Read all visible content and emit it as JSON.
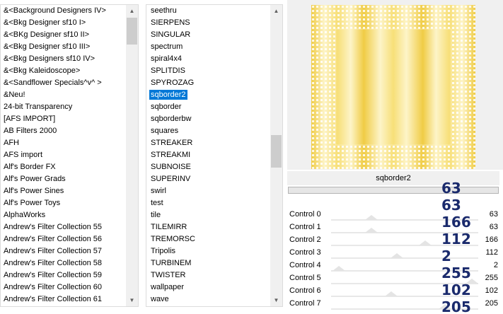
{
  "categories": {
    "items": [
      "&<Background Designers IV>",
      "&<Bkg Designer sf10 I>",
      "&<BKg Designer sf10 II>",
      "&<Bkg Designer sf10 III>",
      "&<Bkg Designers sf10 IV>",
      "&<Bkg Kaleidoscope>",
      "&<Sandflower Specials^v^ >",
      "&Neu!",
      "24-bit Transparency",
      "[AFS IMPORT]",
      "AB Filters 2000",
      "AFH",
      "AFS import",
      "Alf's Border FX",
      "Alf's Power Grads",
      "Alf's Power Sines",
      "Alf's Power Toys",
      "AlphaWorks",
      "Andrew's Filter Collection 55",
      "Andrew's Filter Collection 56",
      "Andrew's Filter Collection 57",
      "Andrew's Filter Collection 58",
      "Andrew's Filter Collection 59",
      "Andrew's Filter Collection 60",
      "Andrew's Filter Collection 61"
    ]
  },
  "filters": {
    "items": [
      "seethru",
      "SIERPENS",
      "SINGULAR",
      "spectrum",
      "spiral4x4",
      "SPLITDIS",
      "SPYROZAG",
      "sqborder2",
      "sqborder",
      "sqborderbw",
      "squares",
      "STREAKER",
      "STREAKMI",
      "SUBNOISE",
      "SUPERINV",
      "swirl",
      "test",
      "tile",
      "TILEMIRR",
      "TREMORSC",
      "Tripolis",
      "TURBINEM",
      "TWISTER",
      "wallpaper",
      "wave"
    ],
    "selected": "sqborder2"
  },
  "preview": {
    "colors": {
      "light": "#fdf4c8",
      "mid": "#f7df78",
      "dark": "#f0cc45",
      "dot": "#ffffff"
    }
  },
  "filter_title": "sqborder2",
  "controls": [
    {
      "label": "Control 0",
      "value": "63",
      "fraction": 0.25
    },
    {
      "label": "Control 1",
      "value": "63",
      "fraction": 0.25
    },
    {
      "label": "Control 2",
      "value": "166",
      "fraction": 0.65
    },
    {
      "label": "Control 3",
      "value": "112",
      "fraction": 0.44
    },
    {
      "label": "Control 4",
      "value": "2",
      "fraction": 0.01
    },
    {
      "label": "Control 5",
      "value": "255",
      "fraction": 1.0
    },
    {
      "label": "Control 6",
      "value": "102",
      "fraction": 0.4
    },
    {
      "label": "Control 7",
      "value": "205",
      "fraction": 0.8
    }
  ],
  "overlay_numbers": [
    "63",
    "63",
    "166",
    "112",
    "2",
    "255",
    "102",
    "205"
  ]
}
